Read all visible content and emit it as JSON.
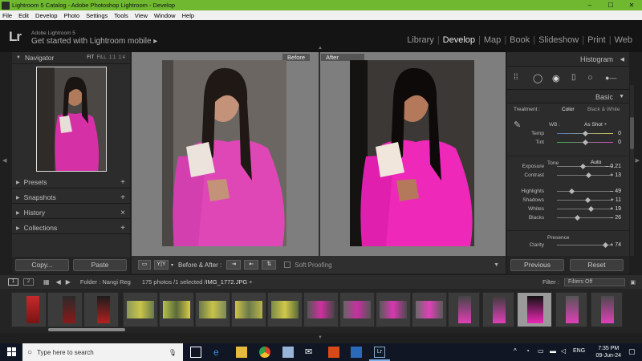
{
  "window": {
    "title": "Lightroom 5 Catalog - Adobe Photoshop Lightroom - Develop"
  },
  "menu": [
    "File",
    "Edit",
    "Develop",
    "Photo",
    "Settings",
    "Tools",
    "View",
    "Window",
    "Help"
  ],
  "identity": {
    "logo": "Lr",
    "app_name": "Adobe Lightroom 5",
    "mobile_text": "Get started with Lightroom mobile ▸"
  },
  "modules": [
    "Library",
    "Develop",
    "Map",
    "Book",
    "Slideshow",
    "Print",
    "Web"
  ],
  "active_module": "Develop",
  "left_panel": {
    "navigator": {
      "label": "Navigator",
      "fit": "FIT",
      "fill": "FILL",
      "one_one": "1:1",
      "one_four": "1:4"
    },
    "sections": [
      {
        "label": "Presets",
        "action": "+"
      },
      {
        "label": "Snapshots",
        "action": "+"
      },
      {
        "label": "History",
        "action": "×"
      },
      {
        "label": "Collections",
        "action": "+"
      }
    ],
    "copy_button": "Copy...",
    "paste_button": "Paste"
  },
  "view": {
    "before_label": "Before",
    "after_label": "After"
  },
  "toolbar": {
    "before_after_label": "Before & After :",
    "soft_proofing_label": "Soft Proofing",
    "yy_label": "Y|Y"
  },
  "right_panel": {
    "histogram_label": "Histogram",
    "basic_label": "Basic",
    "treatment_label": "Treatment :",
    "color_label": "Color",
    "bw_label": "Black & White",
    "wb_label": "WB :",
    "wb_value": "As Shot ÷",
    "tone_label": "Tone",
    "auto_label": "Auto",
    "presence_label": "Presence",
    "sliders": [
      {
        "label": "Temp",
        "value": "0",
        "pos": 0.5
      },
      {
        "label": "Tint",
        "value": "0",
        "pos": 0.5
      },
      {
        "label": "Exposure",
        "value": "– 0.21",
        "pos": 0.47
      },
      {
        "label": "Contrast",
        "value": "+ 13",
        "pos": 0.56
      },
      {
        "label": "Highlights",
        "value": "– 49",
        "pos": 0.26
      },
      {
        "label": "Shadows",
        "value": "+ 11",
        "pos": 0.55
      },
      {
        "label": "Whites",
        "value": "+ 19",
        "pos": 0.6
      },
      {
        "label": "Blacks",
        "value": "– 26",
        "pos": 0.37
      },
      {
        "label": "Clarity",
        "value": "+ 74",
        "pos": 0.87
      }
    ],
    "previous_button": "Previous",
    "reset_button": "Reset"
  },
  "filmbar": {
    "page1": "1",
    "page2": "2",
    "folder": "Folder : Nangi Reg",
    "count": "175 photos /1 selected /",
    "filename": "IMG_1772.JPG ÷",
    "filter_label": "Filter :",
    "filter_value": "Filters Off"
  },
  "taskbar": {
    "search_placeholder": "Type here to search",
    "lang": "ENG",
    "time": "7:35 PM",
    "date": "09-Jun-24"
  }
}
